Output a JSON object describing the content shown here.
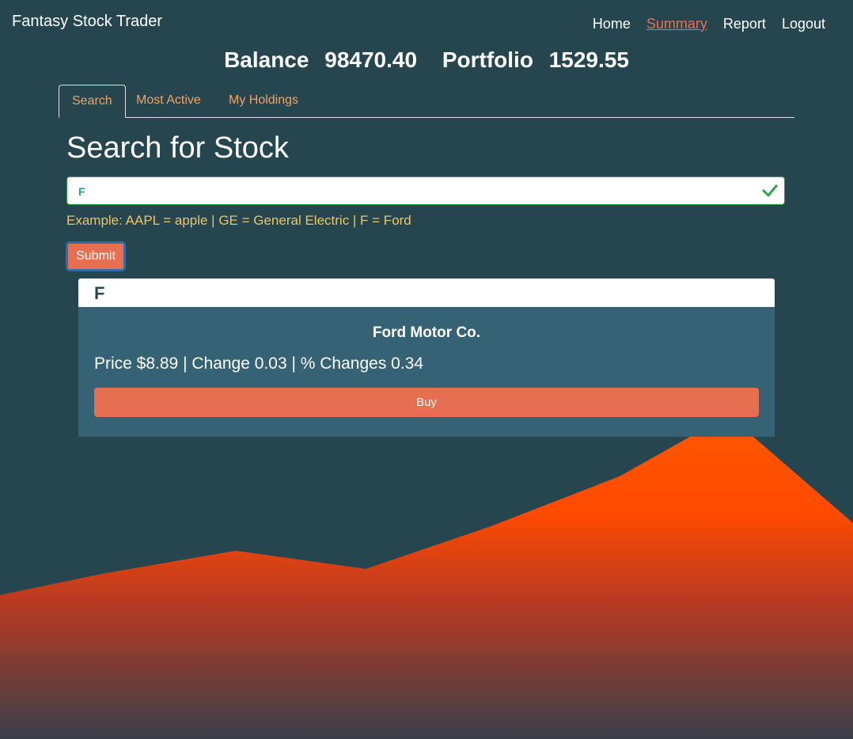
{
  "navbar": {
    "brand": "Fantasy Stock Trader",
    "links": [
      {
        "label": "Home",
        "active": false
      },
      {
        "label": "Summary",
        "active": true
      },
      {
        "label": "Report",
        "active": false
      },
      {
        "label": "Logout",
        "active": false
      }
    ]
  },
  "account": {
    "balance_label": "Balance",
    "balance_value": "98470.40",
    "portfolio_label": "Portfolio",
    "portfolio_value": "1529.55"
  },
  "tabs": [
    {
      "label": "Search",
      "active": true
    },
    {
      "label": "Most Active",
      "active": false
    },
    {
      "label": "My Holdings",
      "active": false
    }
  ],
  "search": {
    "title": "Search for Stock",
    "input_value": "F",
    "valid": true,
    "example": "Example: AAPL = apple | GE = General Electric | F = Ford",
    "submit_label": "Submit"
  },
  "result": {
    "symbol": "F",
    "company": "Ford Motor Co.",
    "price_line": "Price $8.89 | Change 0.03 | % Changes 0.34",
    "buy_label": "Buy"
  },
  "colors": {
    "background": "#26464f",
    "accent": "#e76f51",
    "tab_text": "#f4a261",
    "example_text": "#e9c46a",
    "card_body": "#356275",
    "mountain_top": "#ff5000",
    "mountain_bottom": "#3a3f4a"
  },
  "icons": {
    "valid": "check-icon"
  }
}
